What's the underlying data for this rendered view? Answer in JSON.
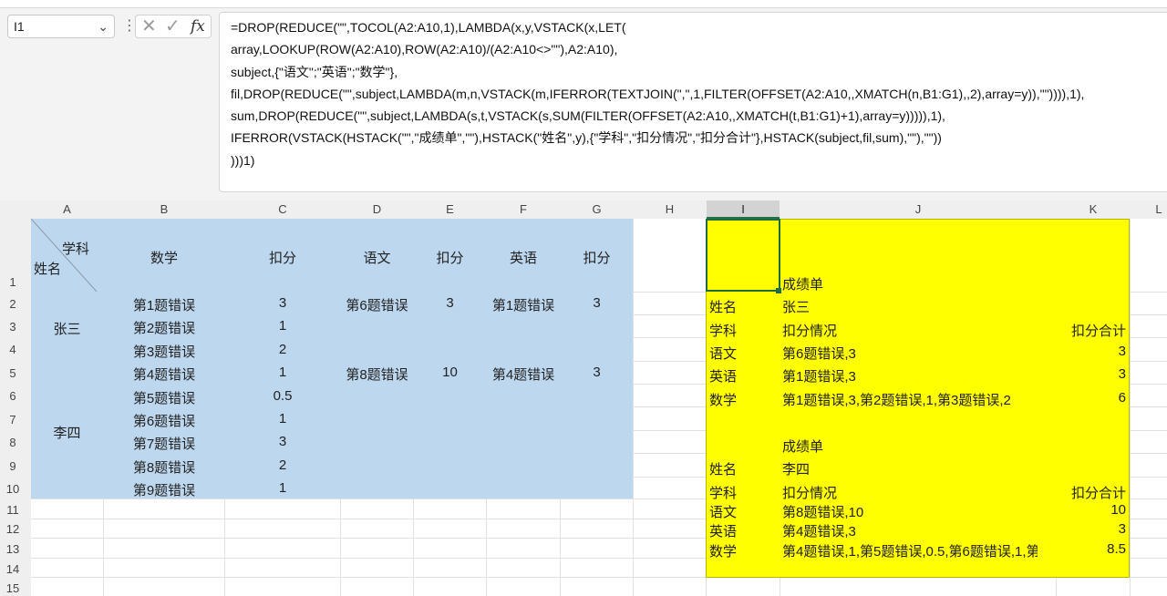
{
  "formula_bar": {
    "name_box": "I1",
    "lines": [
      "=DROP(REDUCE(\"\",TOCOL(A2:A10,1),LAMBDA(x,y,VSTACK(x,LET(",
      "array,LOOKUP(ROW(A2:A10),ROW(A2:A10)/(A2:A10<>\"\"),A2:A10),",
      "subject,{\"语文\";\"英语\";\"数学\"},",
      "fil,DROP(REDUCE(\"\",subject,LAMBDA(m,n,VSTACK(m,IFERROR(TEXTJOIN(\",\",1,FILTER(OFFSET(A2:A10,,XMATCH(n,B1:G1),,2),array=y)),\"\")))),1),",
      "sum,DROP(REDUCE(\"\",subject,LAMBDA(s,t,VSTACK(s,SUM(FILTER(OFFSET(A2:A10,,XMATCH(t,B1:G1)+1),array=y))))),1),",
      "IFERROR(VSTACK(HSTACK(\"\",\"成绩单\",\"\"),HSTACK(\"姓名\",y),{\"学科\",\"扣分情况\",\"扣分合计\"},HSTACK(subject,fil,sum),\"\"),\"\"))",
      ")))1)"
    ]
  },
  "columns": [
    "A",
    "B",
    "C",
    "D",
    "E",
    "F",
    "G",
    "H",
    "I",
    "J",
    "K",
    "L"
  ],
  "rows": [
    "1",
    "2",
    "3",
    "4",
    "5",
    "6",
    "7",
    "8",
    "9",
    "10",
    "11",
    "12",
    "13",
    "14",
    "15"
  ],
  "source_table": {
    "diag_top": "学科",
    "diag_bottom": "姓名",
    "headers": [
      "数学",
      "扣分",
      "语文",
      "扣分",
      "英语",
      "扣分"
    ],
    "names": [
      "张三",
      "李四"
    ],
    "math_items": [
      "第1题错误",
      "第2题错误",
      "第3题错误",
      "第4题错误",
      "第5题错误",
      "第6题错误",
      "第7题错误",
      "第8题错误",
      "第9题错误"
    ],
    "math_scores": [
      "3",
      "1",
      "2",
      "1",
      "0.5",
      "1",
      "3",
      "2",
      "1"
    ],
    "chinese": [
      {
        "item": "第6题错误",
        "score": "3"
      },
      {
        "item": "第8题错误",
        "score": "10"
      }
    ],
    "english": [
      {
        "item": "第1题错误",
        "score": "3"
      },
      {
        "item": "第4题错误",
        "score": "3"
      }
    ]
  },
  "result": {
    "title": "成绩单",
    "name_label": "姓名",
    "subject_label": "学科",
    "detail_label": "扣分情况",
    "total_label": "扣分合计",
    "students": [
      {
        "name": "张三",
        "rows": [
          {
            "subject": "语文",
            "detail": "第6题错误,3",
            "total": "3"
          },
          {
            "subject": "英语",
            "detail": "第1题错误,3",
            "total": "3"
          },
          {
            "subject": "数学",
            "detail": "第1题错误,3,第2题错误,1,第3题错误,2",
            "total": "6"
          }
        ]
      },
      {
        "name": "李四",
        "rows": [
          {
            "subject": "语文",
            "detail": "第8题错误,10",
            "total": "10"
          },
          {
            "subject": "英语",
            "detail": "第4题错误,3",
            "total": "3"
          },
          {
            "subject": "数学",
            "detail": "第4题错误,1,第5题错误,0.5,第6题错误,1,第",
            "total": "8.5"
          }
        ]
      }
    ]
  }
}
